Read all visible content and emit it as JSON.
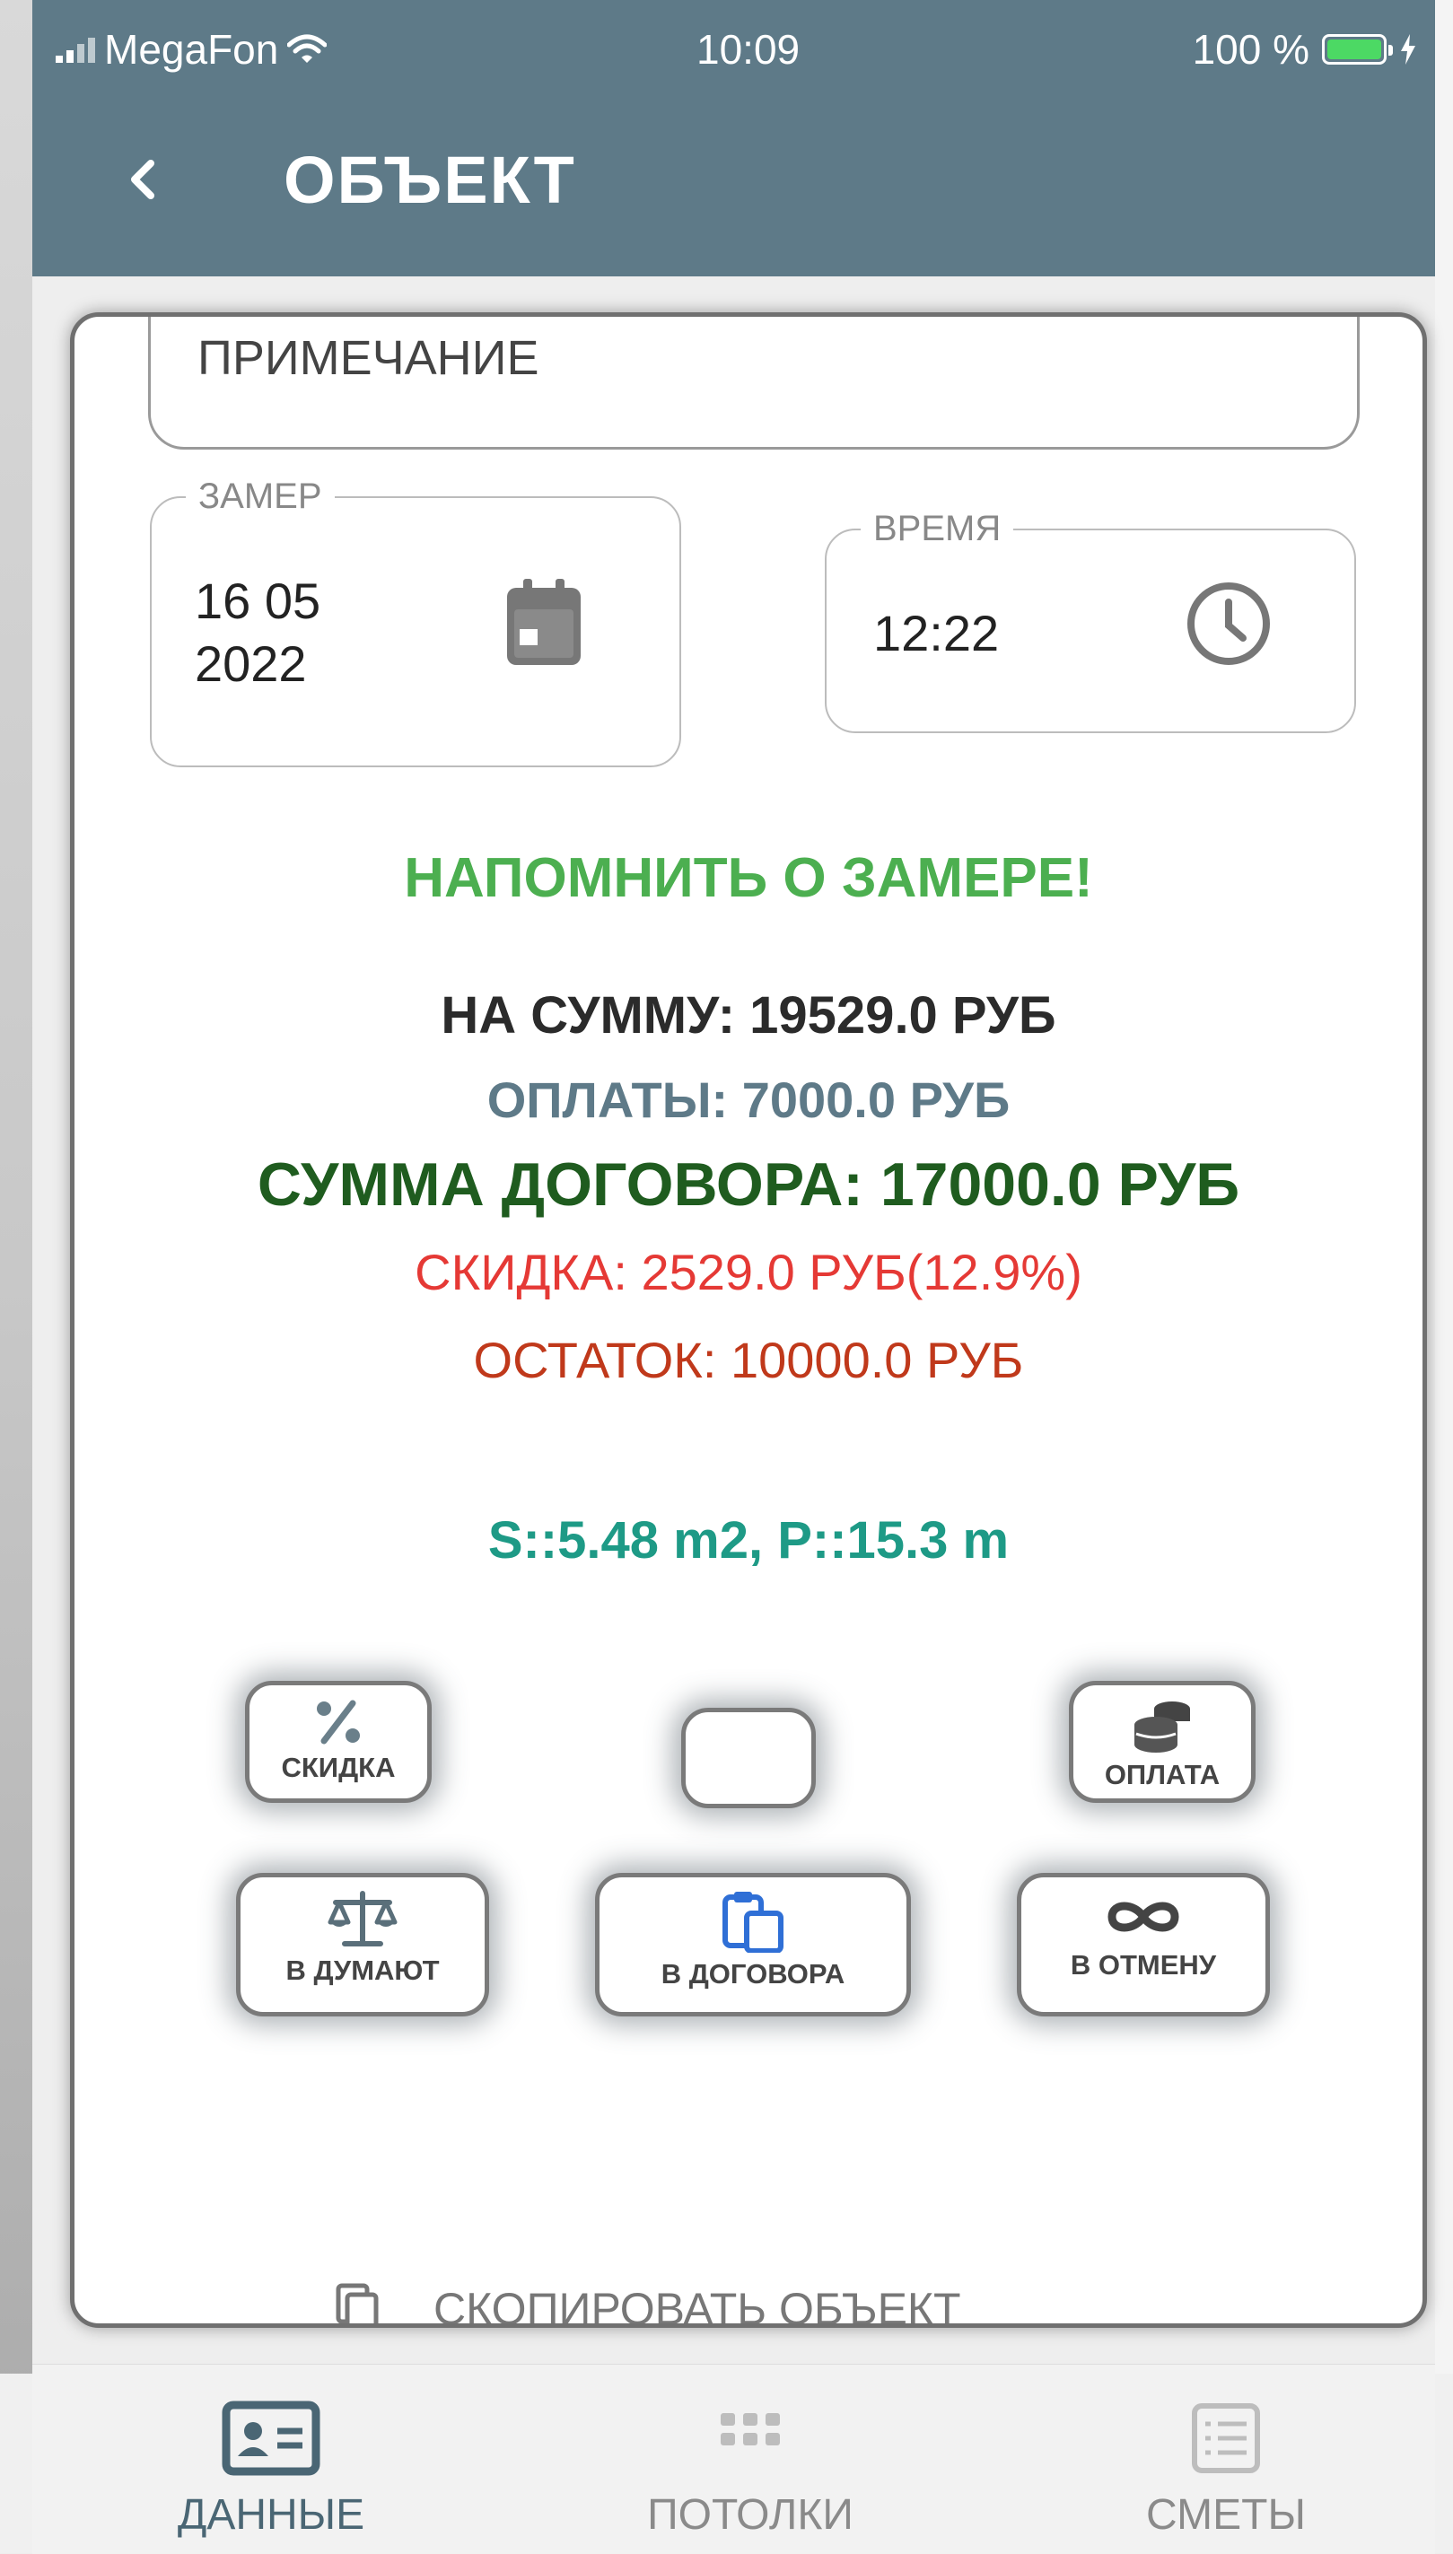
{
  "status": {
    "carrier": "MegaFon",
    "time": "10:09",
    "battery": "100 %"
  },
  "header": {
    "title": "ОБЪЕКТ"
  },
  "form": {
    "note_label": "ПРИМЕЧАНИЕ",
    "date_label": "ЗАМЕР",
    "date_value": "16 05 2022",
    "time_label": "ВРЕМЯ",
    "time_value": "12:22"
  },
  "summary": {
    "remind": "НАПОМНИТЬ О ЗАМЕРЕ!",
    "sum": "НА СУММУ: 19529.0 РУБ",
    "payments": "ОПЛАТЫ: 7000.0 РУБ",
    "contract": "СУММА ДОГОВОРА: 17000.0 РУБ",
    "discount": "СКИДКА: 2529.0 РУБ(12.9%)",
    "rest": "ОСТАТОК: 10000.0 РУБ",
    "area": "S::5.48 m2, P::15.3 m"
  },
  "actions": {
    "discount": "СКИДКА",
    "payment": "ОПЛАТА",
    "to_thinking": "В ДУМАЮТ",
    "to_contracts": "В ДОГОВОРА",
    "to_cancel": "В ОТМЕНУ"
  },
  "copy_object": "СКОПИРОВАТЬ ОБЪЕКТ",
  "tabs": [
    {
      "label": "ДАННЫЕ",
      "icon": "contact-card-icon",
      "active": true
    },
    {
      "label": "ПОТОЛКИ",
      "icon": "grid-icon",
      "active": false
    },
    {
      "label": "СМЕТЫ",
      "icon": "list-icon",
      "active": false
    }
  ],
  "colors": {
    "header": "#5e7a88",
    "remind": "#4caf50",
    "contract": "#1f5c1f",
    "discount": "#e53935",
    "rest": "#c0391b",
    "area": "#1e9a86",
    "active_tab": "#4a6674",
    "inactive_tab": "#9a9a9a"
  }
}
